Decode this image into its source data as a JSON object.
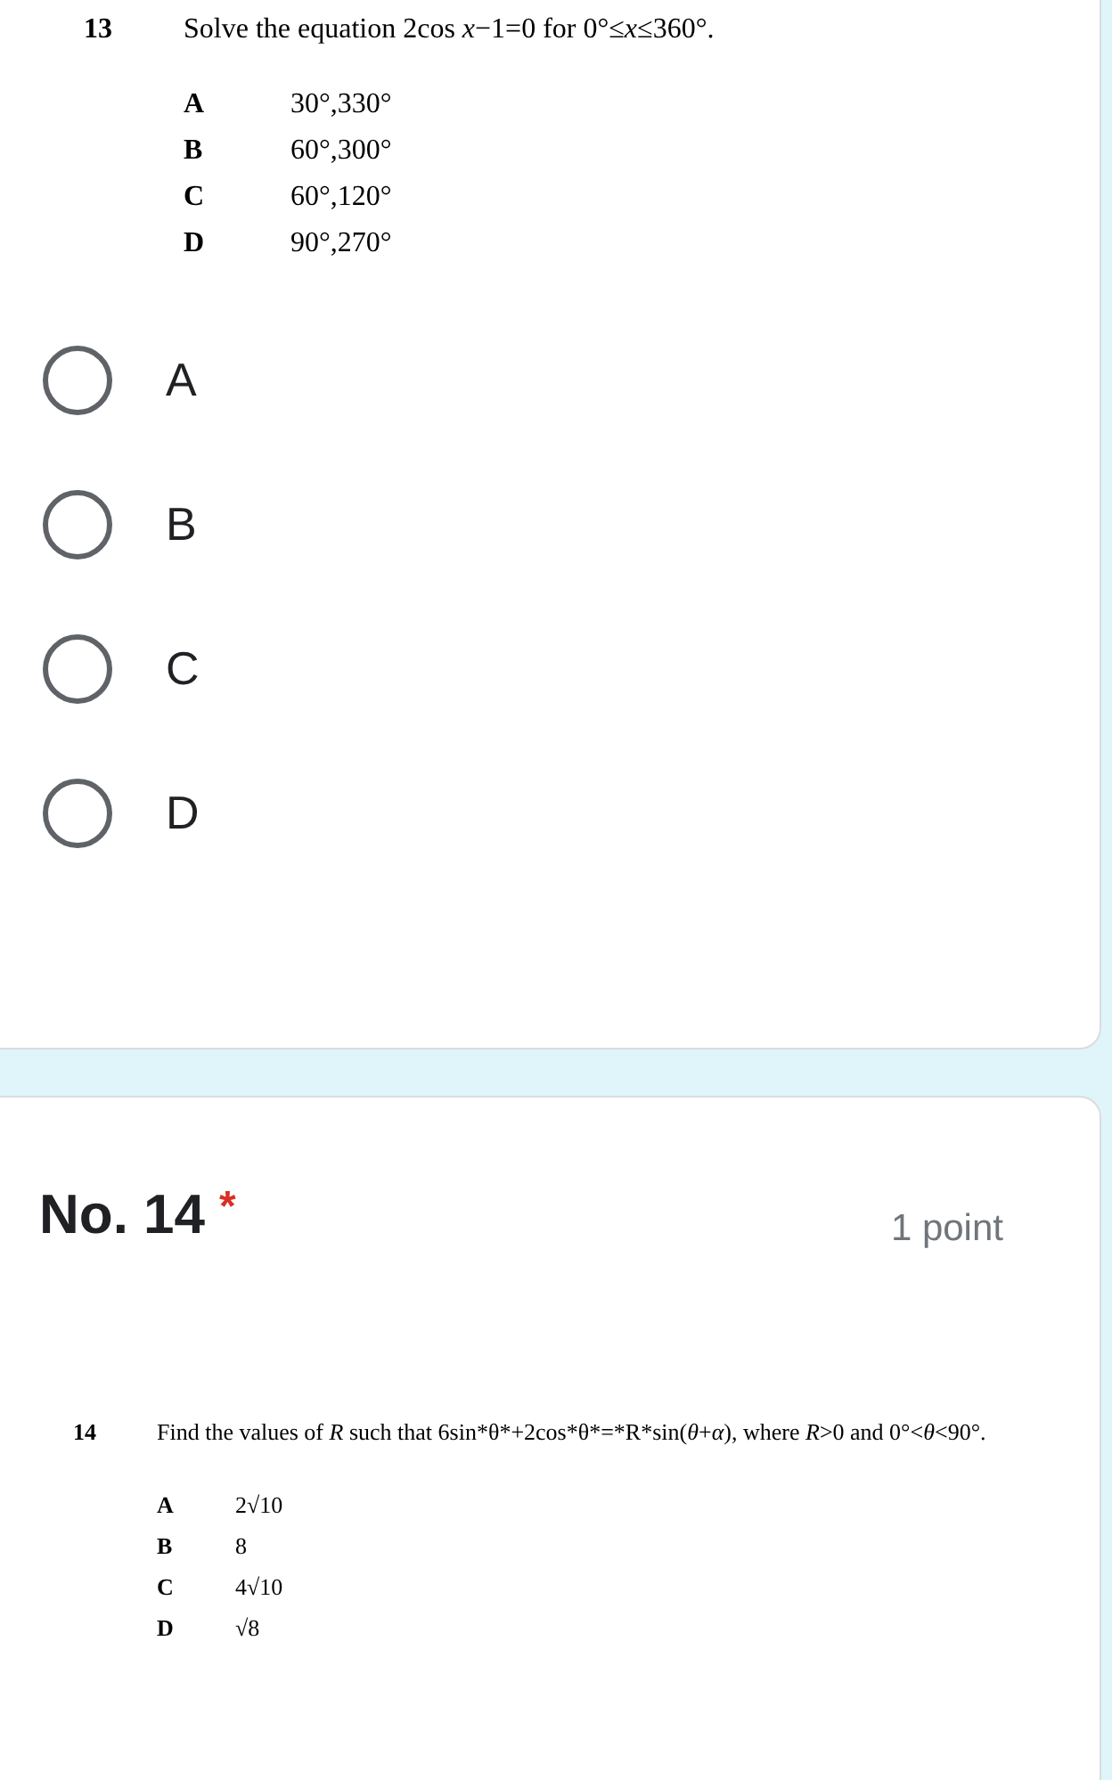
{
  "question_13": {
    "number": "13",
    "stem": "Solve the equation 2cos *x*−1=0 for 0°≤*x*≤360°.",
    "choices": [
      {
        "letter": "A",
        "value": "30°,330°"
      },
      {
        "letter": "B",
        "value": "60°,300°"
      },
      {
        "letter": "C",
        "value": "60°,120°"
      },
      {
        "letter": "D",
        "value": "90°,270°"
      }
    ],
    "options": [
      {
        "label": "A",
        "selected": false
      },
      {
        "label": "B",
        "selected": false
      },
      {
        "label": "C",
        "selected": false
      },
      {
        "label": "D",
        "selected": false
      }
    ]
  },
  "question_14": {
    "title": "No. 14",
    "required_mark": "*",
    "points": "1 point",
    "number": "14",
    "stem": "Find the values of *R* such that 6sin*θ*+2cos*θ*=*R*sin(*θ*+*α*), where *R*>0 and 0°<*θ*<90°.",
    "choices": [
      {
        "letter": "A",
        "value": "2√10"
      },
      {
        "letter": "B",
        "value": "8"
      },
      {
        "letter": "C",
        "value": "4√10"
      },
      {
        "letter": "D",
        "value": "√8"
      }
    ]
  }
}
